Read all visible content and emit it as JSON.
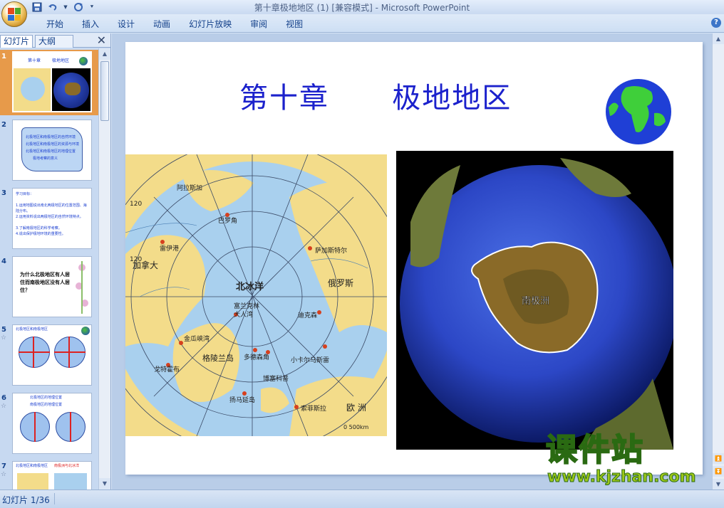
{
  "window": {
    "title": "第十章极地地区 (1) [兼容模式] - Microsoft PowerPoint"
  },
  "ribbon": {
    "tabs": [
      "开始",
      "插入",
      "设计",
      "动画",
      "幻灯片放映",
      "审阅",
      "视图"
    ]
  },
  "panel": {
    "tab_slides": "幻灯片",
    "tab_outline": "大纲",
    "slides": [
      {
        "num": "1",
        "title": "第十章",
        "subtitle": "极地地区"
      },
      {
        "num": "2",
        "lines": [
          "北极地区和南极地区的自然环境",
          "北极地区和南极地区的资源与环境",
          "北极地区和南极地区的地理位置",
          "极地考察的意义"
        ]
      },
      {
        "num": "3",
        "heading": "学习目标：",
        "lines": [
          "1.运用地图说出南北两极地区的位置范围、海陆分布。",
          "2.运用资料说出两极地区的自然环境特点。",
          "3.了解南极地区的科学考察。",
          "4.说出保护极地环境的重要性。"
        ]
      },
      {
        "num": "4",
        "text": "为什么北极地区有人居住而南极地区没有人居住？"
      },
      {
        "num": "5",
        "heading": "北极地区和南极地区"
      },
      {
        "num": "6",
        "lines": [
          "北极地区的地理位置",
          "南极地区的地理位置"
        ]
      },
      {
        "num": "7",
        "heading": "北极地区和南极地区",
        "note": "南极洲与北冰洋"
      }
    ]
  },
  "slide": {
    "title_part1": "第十章",
    "title_part2": "极地地区",
    "map_labels": {
      "north_ocean": "北冰洋",
      "canada": "加拿大",
      "russia": "俄罗斯",
      "greenland": "格陵兰岛",
      "europe": "欧 洲",
      "alaska": "阿拉斯加",
      "barrow": "巴罗角",
      "resolute": "雷伊港",
      "dikson": "迪克森",
      "yamal": "萨加斯特尔",
      "fujin": "富兰克林",
      "big_bay": "大人湾",
      "channel": "金瓜峡湾",
      "nuuk": "戈特霍布",
      "dome": "多德森角",
      "iceland": "扬马延岛",
      "bothnia": "博塞科普",
      "small_pen": "小卡尔马斯雷",
      "murmansk": "索菲斯拉",
      "lat_120a": "120",
      "lat_120b": "120",
      "scale": "0   500km"
    },
    "antarctica_label": "南极洲"
  },
  "status": {
    "slide_of": "幻灯片 1/36"
  },
  "watermark": {
    "main": "课件站",
    "url": "www.kjzhan.com"
  },
  "colors": {
    "title_blue": "#1b21cc",
    "ocean": "#a9d0ee",
    "land": "#f3dc8a",
    "accent": "#e79a4a"
  }
}
